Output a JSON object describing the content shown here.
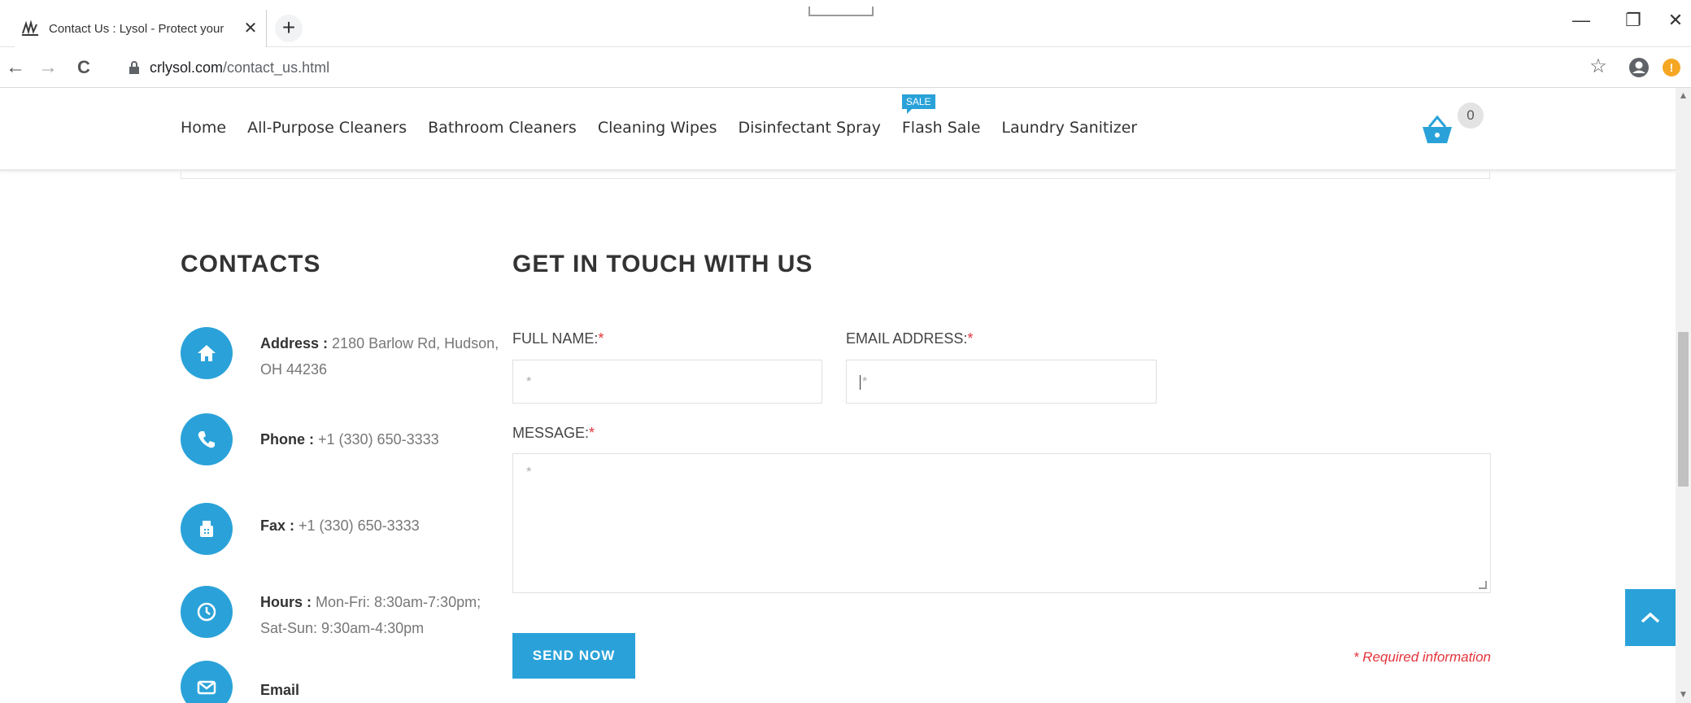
{
  "browser": {
    "tab_title": "Contact Us : Lysol - Protect your",
    "tab_close": "✕",
    "new_tab": "+",
    "window_minimize": "—",
    "window_restore": "❐",
    "window_close": "✕",
    "url_host": "crlysol.com",
    "url_path": "/contact_us.html",
    "back": "←",
    "forward": "→",
    "reload": "C",
    "bookmark_star": "☆",
    "ext_badge": "!"
  },
  "nav": {
    "items": [
      {
        "label": "Home"
      },
      {
        "label": "All-Purpose Cleaners"
      },
      {
        "label": "Bathroom Cleaners"
      },
      {
        "label": "Cleaning Wipes"
      },
      {
        "label": "Disinfectant Spray"
      },
      {
        "label": "Flash Sale",
        "badge": "SALE"
      },
      {
        "label": "Laundry Sanitizer"
      }
    ],
    "cart_count": "0"
  },
  "contacts": {
    "title": "CONTACTS",
    "items": [
      {
        "label": "Address :",
        "value": "2180 Barlow Rd, Hudson, OH 44236",
        "icon": "home-icon"
      },
      {
        "label": "Phone :",
        "value": "+1 (330) 650-3333",
        "icon": "phone-icon"
      },
      {
        "label": "Fax :",
        "value": "+1 (330) 650-3333",
        "icon": "fax-icon"
      },
      {
        "label": "Hours :",
        "value": "Mon-Fri: 8:30am-7:30pm; Sat-Sun: 9:30am-4:30pm",
        "icon": "clock-icon"
      },
      {
        "label": "Email",
        "value": "",
        "icon": "mail-icon"
      }
    ]
  },
  "form": {
    "title": "GET IN TOUCH WITH US",
    "full_name_label": "FULL NAME:",
    "email_label": "EMAIL ADDRESS:",
    "message_label": "MESSAGE:",
    "required_mark": "*",
    "full_name_placeholder": "*",
    "email_placeholder": "*",
    "message_placeholder": "*",
    "submit_label": "SEND NOW",
    "required_note": "* Required information"
  },
  "colors": {
    "accent": "#2aa2d9",
    "required": "#e3343b"
  }
}
